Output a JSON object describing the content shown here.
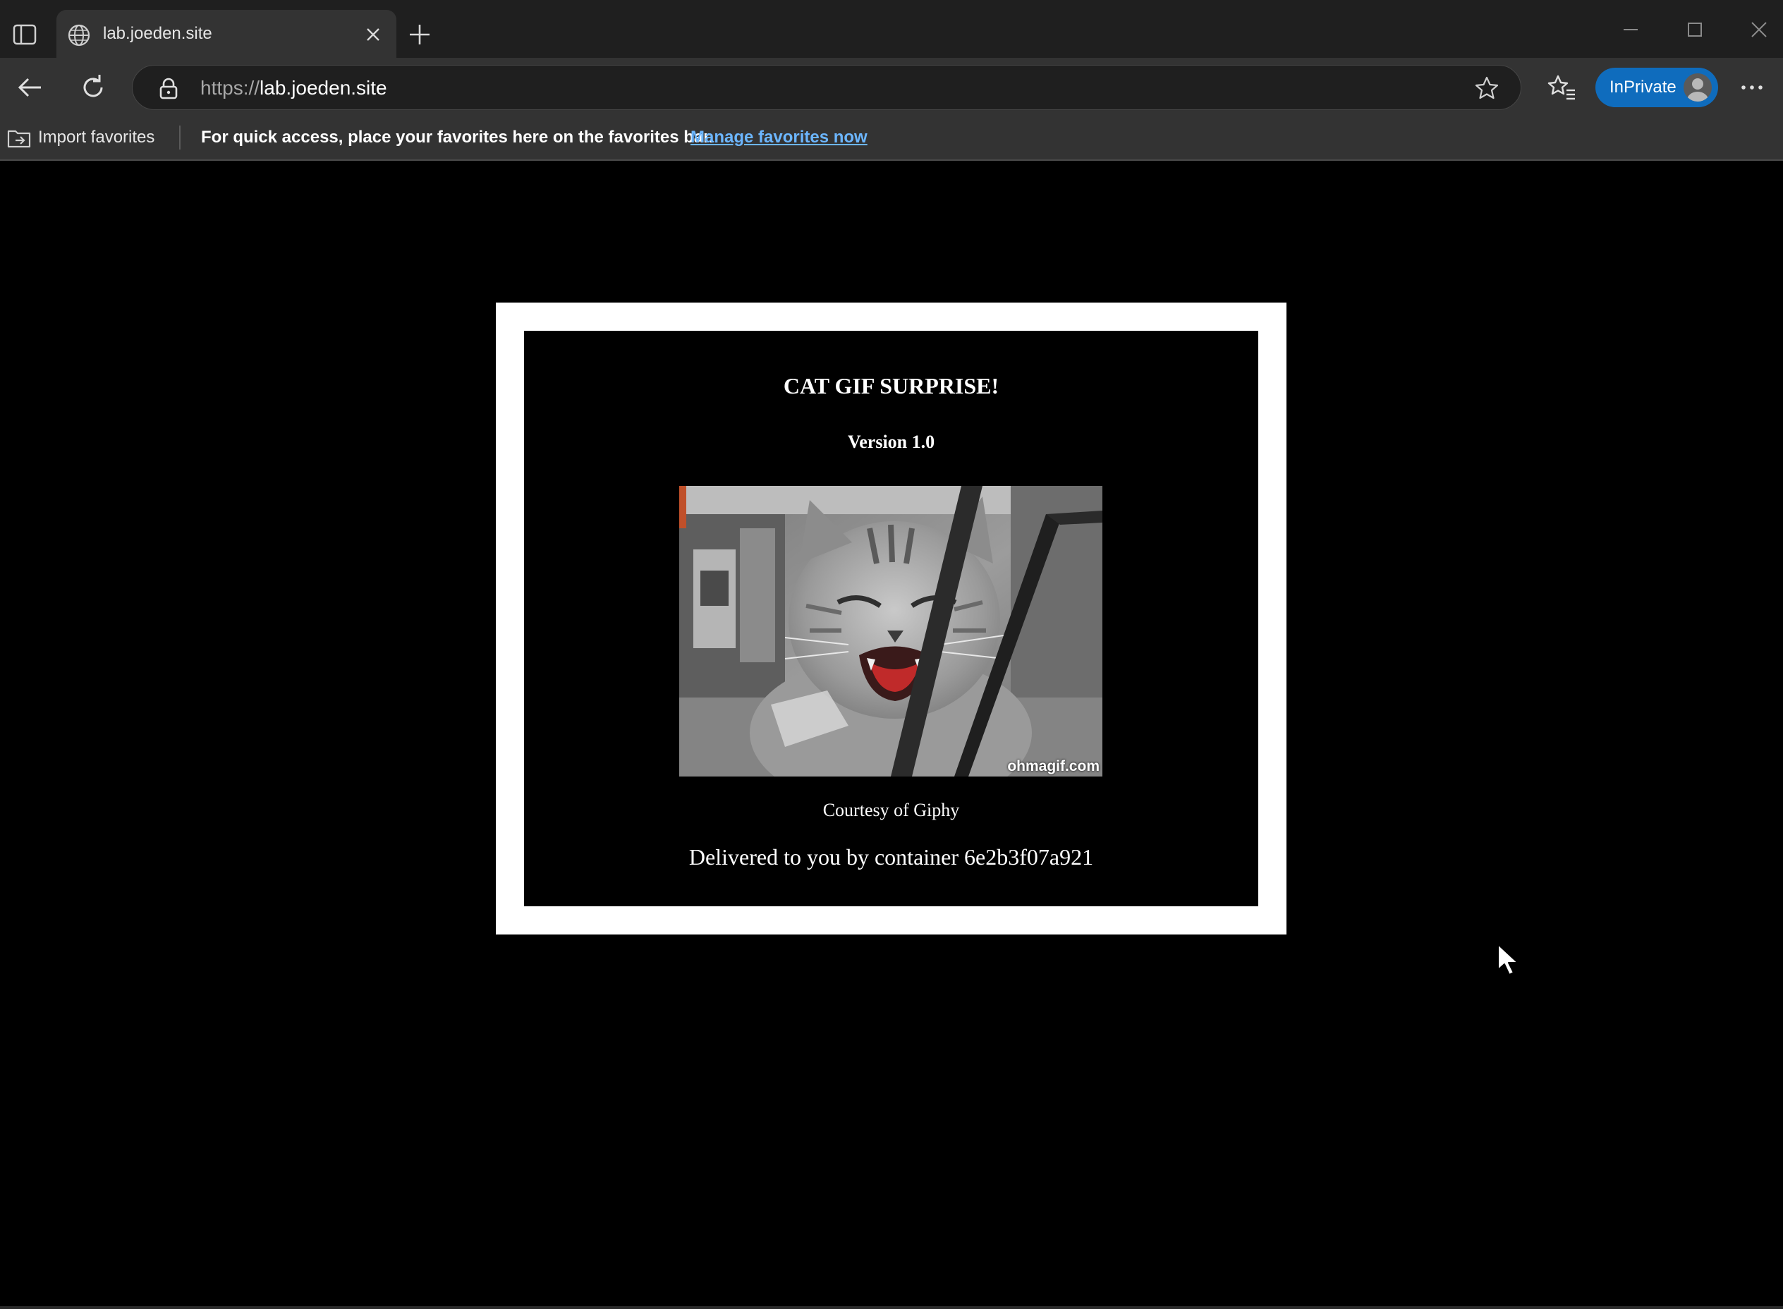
{
  "tab": {
    "title": "lab.joeden.site"
  },
  "address_bar": {
    "scheme": "https://",
    "host": "lab.joeden.site"
  },
  "profile": {
    "inprivate_label": "InPrivate"
  },
  "favorites_bar": {
    "import_label": "Import favorites",
    "hint": "For quick access, place your favorites here on the favorites bar.",
    "manage_link": "Manage favorites now"
  },
  "content": {
    "title": "CAT GIF SURPRISE!",
    "version": "Version 1.0",
    "image_watermark": "ohmagif.com",
    "courtesy": "Courtesy of Giphy",
    "delivered": "Delivered to you by container 6e2b3f07a921"
  },
  "icons": {
    "tab_actions": "tab-actions-icon",
    "globe": "globe-icon",
    "close": "close-icon",
    "new_tab": "plus-icon",
    "back": "back-arrow-icon",
    "refresh": "refresh-icon",
    "lock": "lock-icon",
    "favorite": "star-icon",
    "favorites": "favorites-icon",
    "more": "more-icon"
  },
  "colors": {
    "inprivate": "#0f6cbd",
    "link": "#6cb6ff",
    "page_bg": "#000000",
    "frame": "#ffffff"
  }
}
